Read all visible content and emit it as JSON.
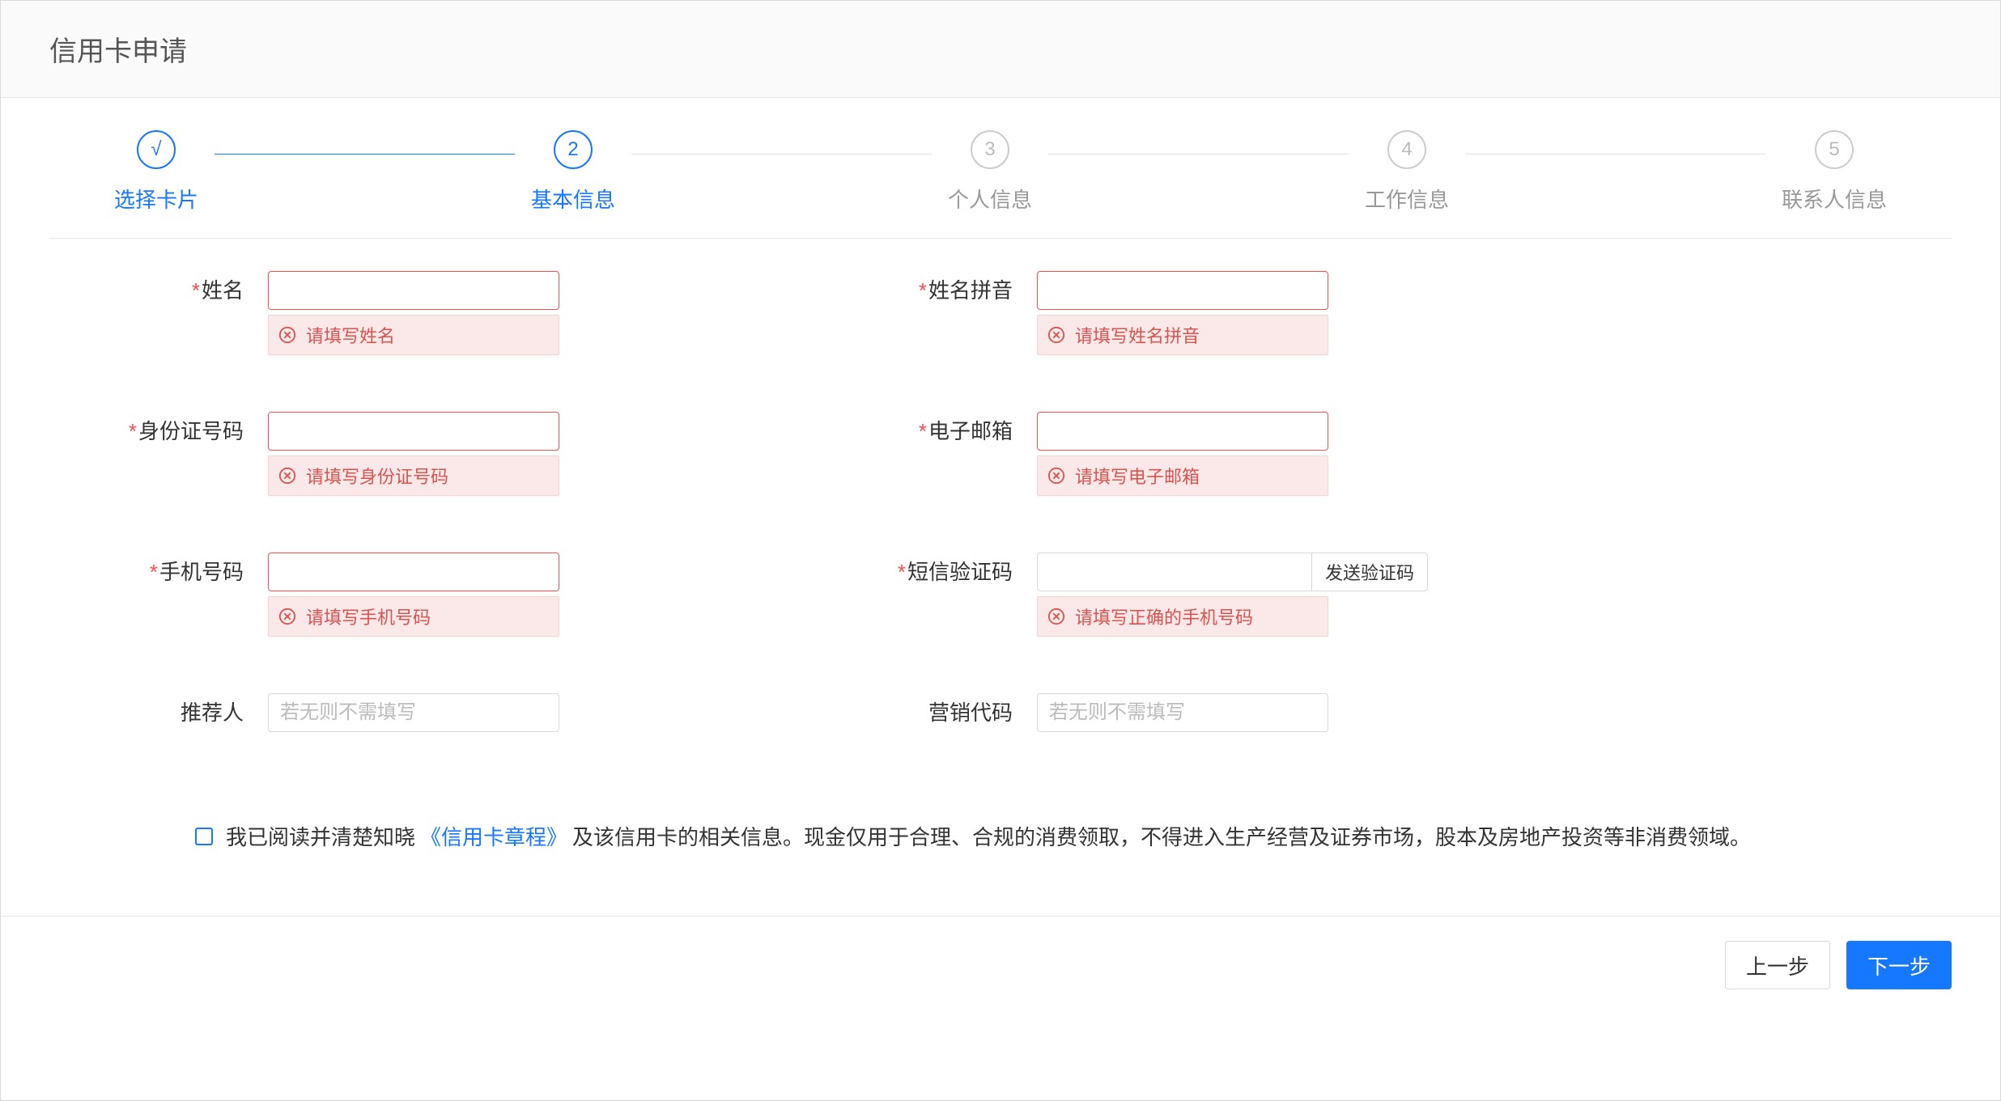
{
  "header": {
    "title": "信用卡申请"
  },
  "steps": [
    {
      "label": "选择卡片",
      "marker": "√",
      "state": "done"
    },
    {
      "label": "基本信息",
      "marker": "2",
      "state": "active"
    },
    {
      "label": "个人信息",
      "marker": "3",
      "state": "pending"
    },
    {
      "label": "工作信息",
      "marker": "4",
      "state": "pending"
    },
    {
      "label": "联系人信息",
      "marker": "5",
      "state": "pending"
    }
  ],
  "form": {
    "name": {
      "label": "姓名",
      "required": true,
      "error": "请填写姓名"
    },
    "pinyin": {
      "label": "姓名拼音",
      "required": true,
      "error": "请填写姓名拼音"
    },
    "idcard": {
      "label": "身份证号码",
      "required": true,
      "error": "请填写身份证号码"
    },
    "email": {
      "label": "电子邮箱",
      "required": true,
      "error": "请填写电子邮箱"
    },
    "phone": {
      "label": "手机号码",
      "required": true,
      "error": "请填写手机号码"
    },
    "sms": {
      "label": "短信验证码",
      "required": true,
      "button": "发送验证码",
      "error": "请填写正确的手机号码"
    },
    "referrer": {
      "label": "推荐人",
      "required": false,
      "placeholder": "若无则不需填写"
    },
    "marketing": {
      "label": "营销代码",
      "required": false,
      "placeholder": "若无则不需填写"
    }
  },
  "agreement": {
    "prefix": "我已阅读并清楚知晓",
    "link": "《信用卡章程》",
    "suffix": "及该信用卡的相关信息。现金仅用于合理、合规的消费领取，不得进入生产经营及证券市场，股本及房地产投资等非消费领域。"
  },
  "footer": {
    "prev": "上一步",
    "next": "下一步"
  }
}
